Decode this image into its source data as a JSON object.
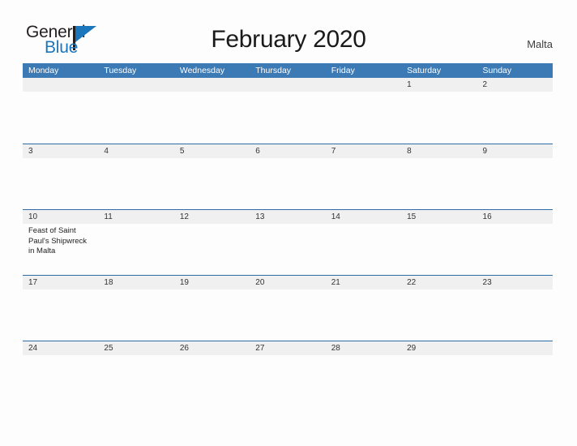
{
  "logo": {
    "word_top": "General",
    "word_bottom": "Blue",
    "triangle_color": "#1b76bc",
    "text_color": "#231f20"
  },
  "header": {
    "title": "February 2020",
    "country": "Malta"
  },
  "theme": {
    "header_blue": "#3b7ab5",
    "row_border_blue": "#2e6da4",
    "band_gray": "#f0f0f0",
    "page_background": "#fdfdfd"
  },
  "calendar": {
    "weekdays": [
      {
        "label": "Monday"
      },
      {
        "label": "Tuesday"
      },
      {
        "label": "Wednesday"
      },
      {
        "label": "Thursday"
      },
      {
        "label": "Friday"
      },
      {
        "label": "Saturday"
      },
      {
        "label": "Sunday"
      }
    ],
    "weeks": [
      {
        "days": [
          {
            "date": "",
            "event": ""
          },
          {
            "date": "",
            "event": ""
          },
          {
            "date": "",
            "event": ""
          },
          {
            "date": "",
            "event": ""
          },
          {
            "date": "",
            "event": ""
          },
          {
            "date": "1",
            "event": ""
          },
          {
            "date": "2",
            "event": ""
          }
        ]
      },
      {
        "days": [
          {
            "date": "3",
            "event": ""
          },
          {
            "date": "4",
            "event": ""
          },
          {
            "date": "5",
            "event": ""
          },
          {
            "date": "6",
            "event": ""
          },
          {
            "date": "7",
            "event": ""
          },
          {
            "date": "8",
            "event": ""
          },
          {
            "date": "9",
            "event": ""
          }
        ]
      },
      {
        "days": [
          {
            "date": "10",
            "event": "Feast of Saint Paul's Shipwreck in Malta"
          },
          {
            "date": "11",
            "event": ""
          },
          {
            "date": "12",
            "event": ""
          },
          {
            "date": "13",
            "event": ""
          },
          {
            "date": "14",
            "event": ""
          },
          {
            "date": "15",
            "event": ""
          },
          {
            "date": "16",
            "event": ""
          }
        ]
      },
      {
        "days": [
          {
            "date": "17",
            "event": ""
          },
          {
            "date": "18",
            "event": ""
          },
          {
            "date": "19",
            "event": ""
          },
          {
            "date": "20",
            "event": ""
          },
          {
            "date": "21",
            "event": ""
          },
          {
            "date": "22",
            "event": ""
          },
          {
            "date": "23",
            "event": ""
          }
        ]
      },
      {
        "days": [
          {
            "date": "24",
            "event": ""
          },
          {
            "date": "25",
            "event": ""
          },
          {
            "date": "26",
            "event": ""
          },
          {
            "date": "27",
            "event": ""
          },
          {
            "date": "28",
            "event": ""
          },
          {
            "date": "29",
            "event": ""
          },
          {
            "date": "",
            "event": ""
          }
        ]
      }
    ]
  }
}
